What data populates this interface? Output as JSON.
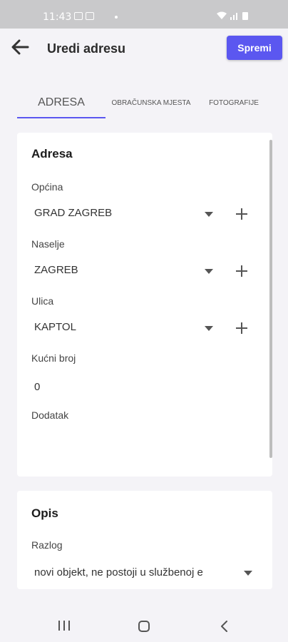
{
  "status_bar": {
    "time": "11:43"
  },
  "header": {
    "title": "Uredi adresu",
    "save_label": "Spremi"
  },
  "tabs": [
    {
      "label": "ADRESA",
      "active": true
    },
    {
      "label": "OBRAČUNSKA MJESTA",
      "active": false
    },
    {
      "label": "FOTOGRAFIJE",
      "active": false
    }
  ],
  "address_card": {
    "title": "Adresa",
    "fields": {
      "opcina": {
        "label": "Općina",
        "value": "GRAD ZAGREB"
      },
      "naselje": {
        "label": "Naselje",
        "value": "ZAGREB"
      },
      "ulica": {
        "label": "Ulica",
        "value": "KAPTOL"
      },
      "kucni_broj": {
        "label": "Kućni broj",
        "value": "0"
      },
      "dodatak": {
        "label": "Dodatak",
        "value": ""
      }
    }
  },
  "description_card": {
    "title": "Opis",
    "fields": {
      "razlog": {
        "label": "Razlog",
        "value": "novi objekt, ne postoji u službenoj e"
      }
    }
  },
  "colors": {
    "accent": "#5b57f0",
    "background": "#f4f3f7",
    "card": "#ffffff"
  }
}
